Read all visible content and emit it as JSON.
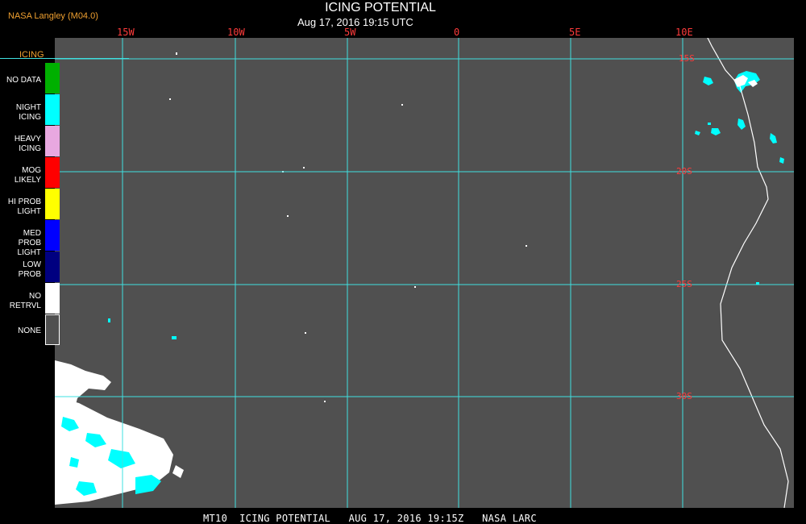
{
  "header": {
    "credit": "NASA Langley (M04.0)",
    "title": "ICING POTENTIAL",
    "subtitle": "Aug 17, 2016 19:15 UTC"
  },
  "map": {
    "background": "#505050",
    "grid_color": "#3fe0e0",
    "coast_color": "#ffffff",
    "lon_labels": [
      "15W",
      "10W",
      "5W",
      "0",
      "5E",
      "10E"
    ],
    "lat_labels": [
      "15S",
      "20S",
      "25S",
      "30S"
    ]
  },
  "legend": {
    "title": "ICING",
    "items": [
      {
        "label_1": "NO DATA",
        "label_2": "",
        "color": "#00b000"
      },
      {
        "label_1": "NIGHT",
        "label_2": "ICING",
        "color": "#00ffff"
      },
      {
        "label_1": "HEAVY",
        "label_2": "ICING",
        "color": "#e8a8e0"
      },
      {
        "label_1": "MOG",
        "label_2": "LIKELY",
        "color": "#ff0000"
      },
      {
        "label_1": "HI PROB",
        "label_2": "LIGHT",
        "color": "#ffff00"
      },
      {
        "label_1": "MED PROB",
        "label_2": "LIGHT",
        "color": "#0000ff"
      },
      {
        "label_1": "LOW",
        "label_2": "PROB",
        "color": "#000080"
      },
      {
        "label_1": "NO",
        "label_2": "RETRVL",
        "color": "#ffffff"
      },
      {
        "label_1": "NONE",
        "label_2": "",
        "color": "#505050"
      }
    ]
  },
  "footer": {
    "text": "MT10  ICING POTENTIAL   AUG 17, 2016 19:15Z   NASA LARC"
  }
}
